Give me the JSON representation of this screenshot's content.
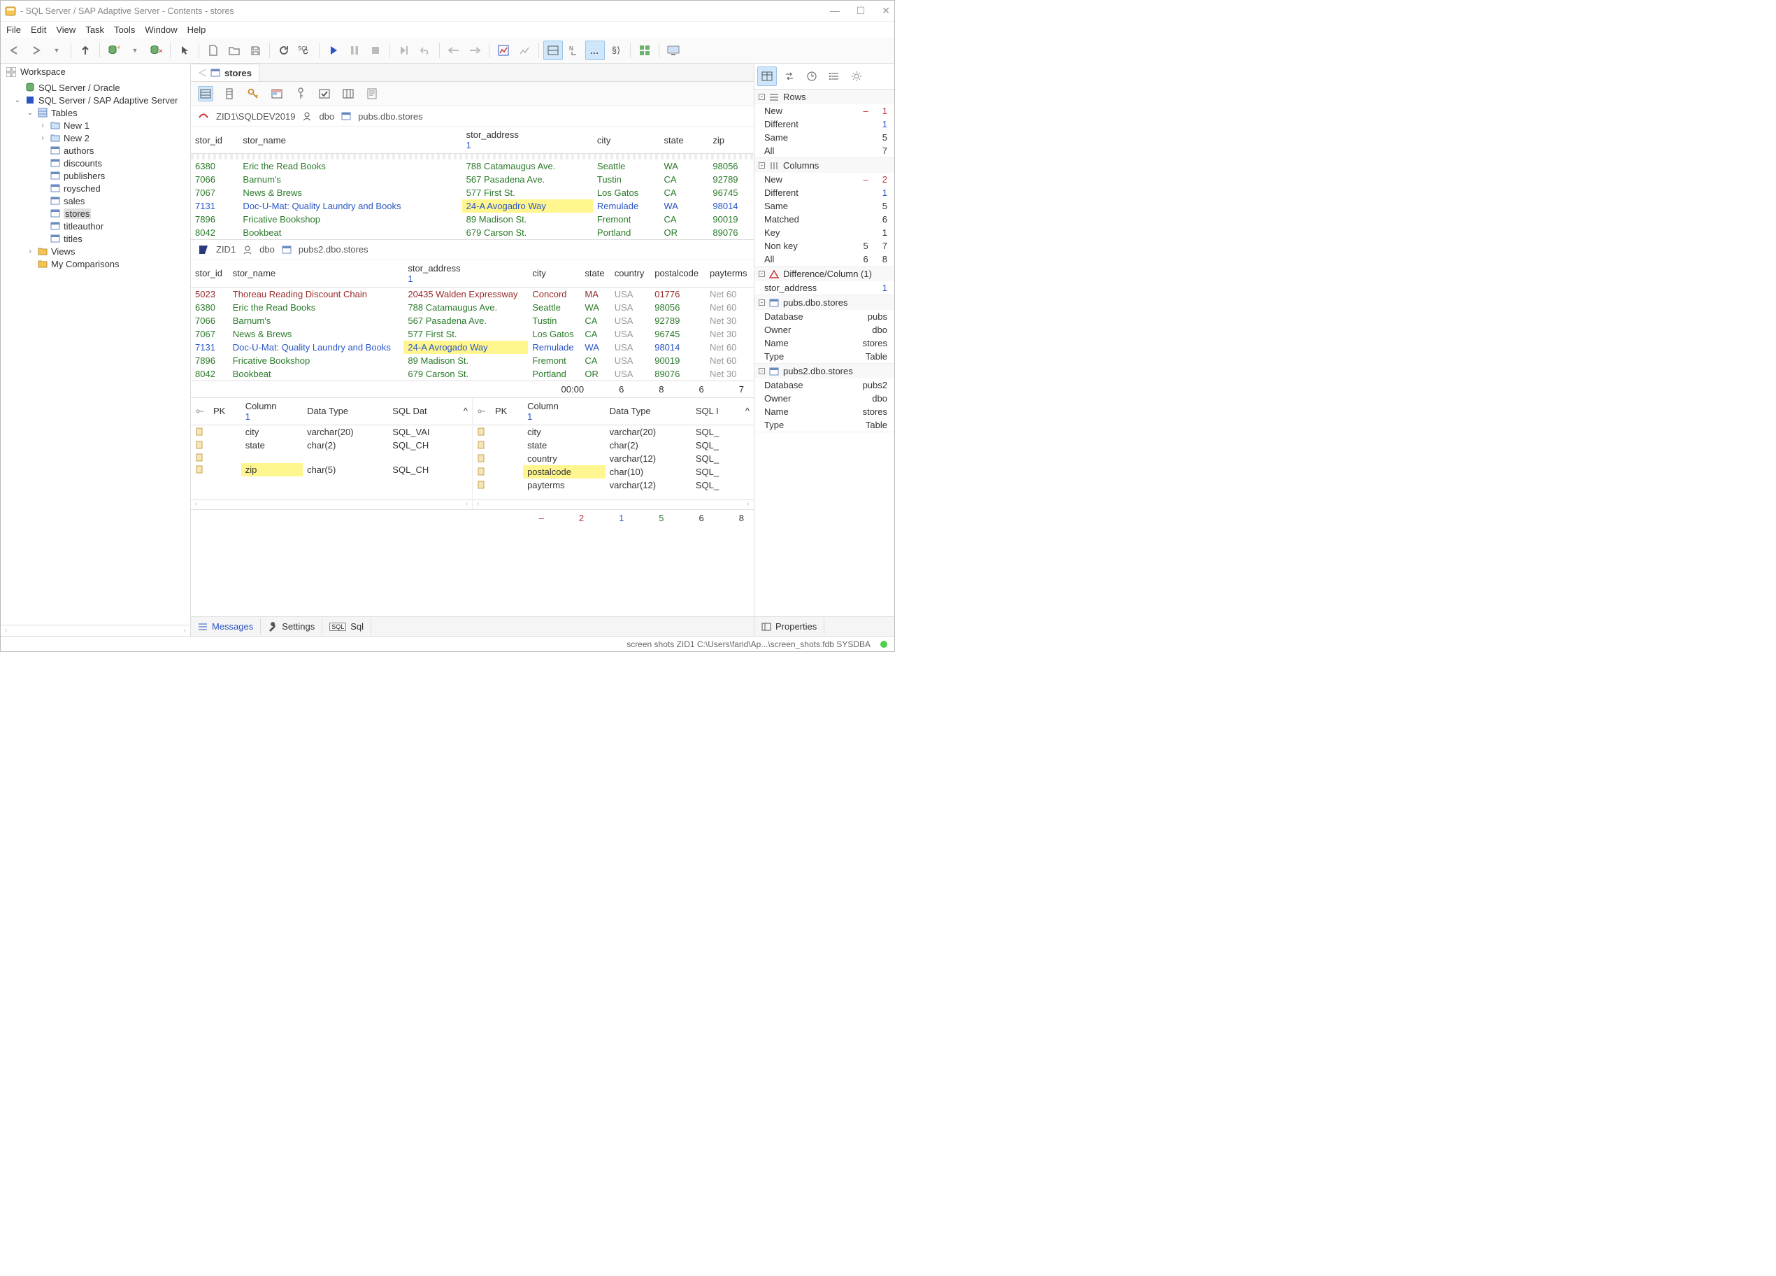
{
  "title": "- SQL Server / SAP Adaptive Server - Contents - stores",
  "menu": [
    "File",
    "Edit",
    "View",
    "Task",
    "Tools",
    "Window",
    "Help"
  ],
  "workspace": {
    "header": "Workspace",
    "root1": "SQL Server / Oracle",
    "root2": "SQL Server / SAP Adaptive Server",
    "tables_label": "Tables",
    "new1": "New 1",
    "new2": "New 2",
    "tables": [
      "authors",
      "discounts",
      "publishers",
      "roysched",
      "sales",
      "stores",
      "titleauthor",
      "titles"
    ],
    "views": "Views",
    "mycomp": "My Comparisons"
  },
  "tab_title": "stores",
  "bc1": {
    "server": "ZID1\\SQLDEV2019",
    "user": "dbo",
    "obj": "pubs.dbo.stores"
  },
  "bc2": {
    "server": "ZID1",
    "user": "dbo",
    "obj": "pubs2.dbo.stores"
  },
  "grid1_headers": [
    "stor_id",
    "stor_name",
    "stor_address",
    "city",
    "state",
    "",
    "zip"
  ],
  "grid1_sub": "1",
  "grid1_rows": [
    {
      "c": [
        "6380",
        "Eric the Read Books",
        "788 Catamaugus Ave.",
        "Seattle",
        "WA",
        "",
        "98056"
      ],
      "style": "g"
    },
    {
      "c": [
        "7066",
        "Barnum's",
        "567 Pasadena Ave.",
        "Tustin",
        "CA",
        "",
        "92789"
      ],
      "style": "g"
    },
    {
      "c": [
        "7067",
        "News & Brews",
        "577 First St.",
        "Los Gatos",
        "CA",
        "",
        "96745"
      ],
      "style": "g"
    },
    {
      "c": [
        "7131",
        "Doc-U-Mat: Quality Laundry and Books",
        "24-A Avogadro Way",
        "Remulade",
        "WA",
        "",
        "98014"
      ],
      "style": "b",
      "hl": 2
    },
    {
      "c": [
        "7896",
        "Fricative Bookshop",
        "89 Madison St.",
        "Fremont",
        "CA",
        "",
        "90019"
      ],
      "style": "g"
    },
    {
      "c": [
        "8042",
        "Bookbeat",
        "679 Carson St.",
        "Portland",
        "OR",
        "",
        "89076"
      ],
      "style": "g"
    }
  ],
  "grid2_headers": [
    "stor_id",
    "stor_name",
    "stor_address",
    "city",
    "state",
    "country",
    "postalcode",
    "payterms"
  ],
  "grid2_sub": "1",
  "grid2_rows": [
    {
      "c": [
        "5023",
        "Thoreau Reading Discount Chain",
        "20435 Walden Expressway",
        "Concord",
        "MA",
        "USA",
        "01776",
        "Net 60"
      ],
      "style": "r"
    },
    {
      "c": [
        "6380",
        "Eric the Read Books",
        "788 Catamaugus Ave.",
        "Seattle",
        "WA",
        "USA",
        "98056",
        "Net 60"
      ],
      "style": "g"
    },
    {
      "c": [
        "7066",
        "Barnum's",
        "567 Pasadena Ave.",
        "Tustin",
        "CA",
        "USA",
        "92789",
        "Net 30"
      ],
      "style": "g"
    },
    {
      "c": [
        "7067",
        "News & Brews",
        "577 First St.",
        "Los Gatos",
        "CA",
        "USA",
        "96745",
        "Net 30"
      ],
      "style": "g"
    },
    {
      "c": [
        "7131",
        "Doc-U-Mat: Quality Laundry and Books",
        "24-A Avrogado Way",
        "Remulade",
        "WA",
        "USA",
        "98014",
        "Net 60"
      ],
      "style": "b",
      "hl": 2
    },
    {
      "c": [
        "7896",
        "Fricative Bookshop",
        "89 Madison St.",
        "Fremont",
        "CA",
        "USA",
        "90019",
        "Net 60"
      ],
      "style": "g"
    },
    {
      "c": [
        "8042",
        "Bookbeat",
        "679 Carson St.",
        "Portland",
        "OR",
        "USA",
        "89076",
        "Net 30"
      ],
      "style": "g"
    }
  ],
  "timer": "00:00",
  "timer_nums": [
    "6",
    "8",
    "6",
    "7"
  ],
  "schema_headers": [
    "PK",
    "Column",
    "Data Type",
    "SQL Dat"
  ],
  "schema_headers2": [
    "PK",
    "Column",
    "Data Type",
    "SQL I"
  ],
  "schema_sub": "1",
  "schema1": [
    {
      "col": "city",
      "dt": "varchar(20)",
      "sql": "SQL_VAI",
      "style": "g"
    },
    {
      "col": "state",
      "dt": "char(2)",
      "sql": "SQL_CH",
      "style": "g"
    },
    {
      "col": "",
      "dt": "",
      "sql": "",
      "style": ""
    },
    {
      "col": "zip",
      "dt": "char(5)",
      "sql": "SQL_CH",
      "style": "g",
      "hl": true
    }
  ],
  "schema2": [
    {
      "col": "city",
      "dt": "varchar(20)",
      "sql": "SQL_",
      "style": "g"
    },
    {
      "col": "state",
      "dt": "char(2)",
      "sql": "SQL_",
      "style": "g"
    },
    {
      "col": "country",
      "dt": "varchar(12)",
      "sql": "SQL_",
      "style": "r"
    },
    {
      "col": "postalcode",
      "dt": "char(10)",
      "sql": "SQL_",
      "style": "r",
      "hl": true
    },
    {
      "col": "payterms",
      "dt": "varchar(12)",
      "sql": "SQL_",
      "style": "r"
    }
  ],
  "bottom_stats": [
    "–",
    "2",
    "1",
    "5",
    "6",
    "8"
  ],
  "bottom_tabs": {
    "messages": "Messages",
    "settings": "Settings",
    "sql": "Sql"
  },
  "right": {
    "rows_h": "Rows",
    "rows": [
      [
        "New",
        "–",
        "1",
        "red"
      ],
      [
        "Different",
        "",
        "1",
        "blue"
      ],
      [
        "Same",
        "",
        "5",
        ""
      ],
      [
        "All",
        "",
        "7",
        ""
      ]
    ],
    "cols_h": "Columns",
    "cols": [
      [
        "New",
        "–",
        "2",
        "red"
      ],
      [
        "Different",
        "",
        "1",
        "blue"
      ],
      [
        "Same",
        "",
        "5",
        ""
      ],
      [
        "Matched",
        "",
        "6",
        ""
      ],
      [
        "Key",
        "",
        "1",
        ""
      ],
      [
        "Non key",
        "5",
        "7",
        ""
      ],
      [
        "All",
        "6",
        "8",
        ""
      ]
    ],
    "diff_h": "Difference/Column (1)",
    "diff": [
      [
        "stor_address",
        "",
        "1",
        "blue"
      ]
    ],
    "obj1_h": "pubs.dbo.stores",
    "obj1": [
      [
        "Database",
        "pubs"
      ],
      [
        "Owner",
        "dbo"
      ],
      [
        "Name",
        "stores"
      ],
      [
        "Type",
        "Table"
      ]
    ],
    "obj2_h": "pubs2.dbo.stores",
    "obj2": [
      [
        "Database",
        "pubs2"
      ],
      [
        "Owner",
        "dbo"
      ],
      [
        "Name",
        "stores"
      ],
      [
        "Type",
        "Table"
      ]
    ],
    "properties": "Properties"
  },
  "status": "screen shots  ZID1  C:\\Users\\farid\\Ap...\\screen_shots.fdb   SYSDBA"
}
